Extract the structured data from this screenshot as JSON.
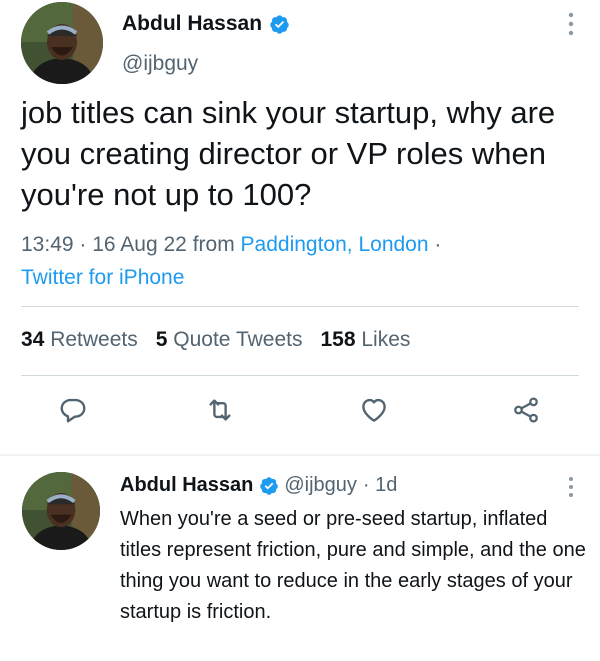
{
  "main_tweet": {
    "display_name": "Abdul Hassan",
    "handle": "@ijbguy",
    "text": "job titles can sink your startup, why are you creating director or VP roles when you're not up to 100?",
    "time": "13:49",
    "date": "16 Aug 22",
    "from_label": "from",
    "location": "Paddington, London",
    "separator": "·",
    "client": "Twitter for iPhone",
    "stats": {
      "retweets_count": "34",
      "retweets_label": "Retweets",
      "quotes_count": "5",
      "quotes_label": "Quote Tweets",
      "likes_count": "158",
      "likes_label": "Likes"
    }
  },
  "reply": {
    "display_name": "Abdul Hassan",
    "handle": "@ijbguy",
    "age": "· 1d",
    "text": "When you're a seed or pre-seed startup, inflated titles represent friction, pure and simple, and the one thing you want to reduce in the early stages of your startup is friction."
  },
  "icons": [
    "verified-badge-icon",
    "more-icon",
    "reply-icon",
    "retweet-icon",
    "like-icon",
    "share-icon"
  ],
  "colors": {
    "accent": "#1d9bf0",
    "text": "#0f1419",
    "secondary": "#536471",
    "divider": "#cfd9de"
  }
}
